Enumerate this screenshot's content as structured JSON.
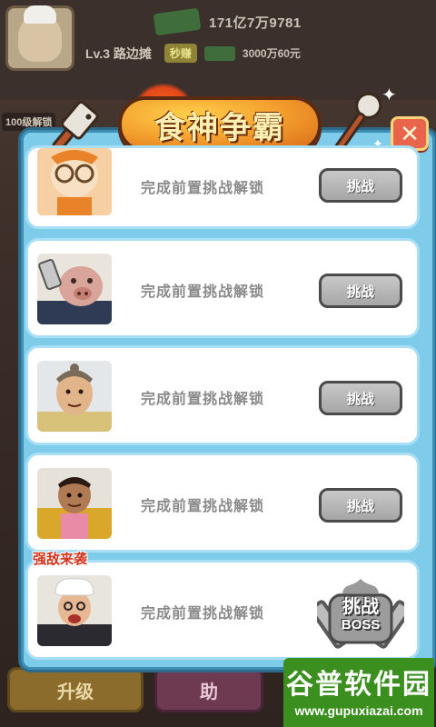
{
  "background": {
    "money_amount": "171亿7万9781",
    "level_text": "Lv.3 路边摊",
    "speed_label": "秒赚",
    "cash_rate": "3000万60元",
    "side_badge": "100级解锁",
    "upgrade_label": "升级",
    "help_label": "助"
  },
  "modal": {
    "title": "食神争霸",
    "close_label": "✕",
    "cards": [
      {
        "label": "完成前置挑战解锁",
        "button": "挑战",
        "character": "chef-cat-girl"
      },
      {
        "label": "完成前置挑战解锁",
        "button": "挑战",
        "character": "pig-butcher"
      },
      {
        "label": "完成前置挑战解锁",
        "button": "挑战",
        "character": "monk"
      },
      {
        "label": "完成前置挑战解锁",
        "button": "挑战",
        "character": "armored-warrior"
      },
      {
        "label": "完成前置挑战解锁",
        "button": "挑战BOSS",
        "character": "boss-chef",
        "tag": "强敌来袭"
      }
    ],
    "boss_line1": "挑战",
    "boss_line2": "BOSS"
  },
  "watermark": {
    "title": "谷普软件园",
    "url": "www.gupuxiazai.com"
  },
  "colors": {
    "modal_bg": "#7fcbea",
    "card_bg": "#ffffff",
    "button_grey": "#b5b5b5",
    "close_red": "#e8644a",
    "banner_orange": "#f19a2b",
    "enemy_tag_red": "#d6331b",
    "watermark_green": "#3a8f1e"
  }
}
